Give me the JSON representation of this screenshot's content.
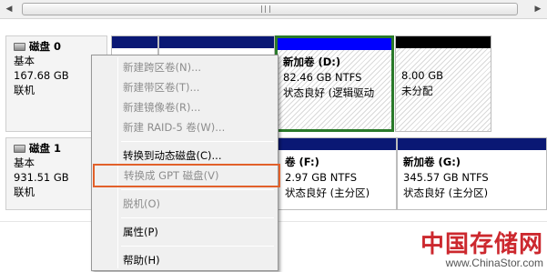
{
  "scrollbar": {
    "left_arrow": "◀",
    "right_arrow": "▶"
  },
  "disk0": {
    "title": "磁盘 0",
    "type": "基本",
    "size": "167.68 GB",
    "status": "联机",
    "partitions": [
      {
        "name": "新加卷 (D:)",
        "size": "82.46 GB NTFS",
        "status": "状态良好 (逻辑驱动"
      },
      {
        "name": "",
        "size": "8.00 GB",
        "status": "未分配"
      }
    ]
  },
  "disk1": {
    "title": "磁盘 1",
    "type": "基本",
    "size": "931.51 GB",
    "status": "联机",
    "partitions": [
      {
        "name": "卷 (F:)",
        "size": "2.97 GB NTFS",
        "status": "状态良好 (主分区)"
      },
      {
        "name": "新加卷 (G:)",
        "size": "345.57 GB NTFS",
        "status": "状态良好 (主分区)"
      }
    ]
  },
  "context_menu": {
    "items": [
      {
        "label": "新建跨区卷(N)...",
        "enabled": false
      },
      {
        "label": "新建带区卷(T)...",
        "enabled": false
      },
      {
        "label": "新建镜像卷(R)...",
        "enabled": false
      },
      {
        "label": "新建 RAID-5 卷(W)...",
        "enabled": false
      },
      {
        "label": "转换到动态磁盘(C)...",
        "enabled": true
      },
      {
        "label": "转换成 GPT 磁盘(V)",
        "enabled": false
      },
      {
        "label": "脱机(O)",
        "enabled": false
      },
      {
        "label": "属性(P)",
        "enabled": true
      },
      {
        "label": "帮助(H)",
        "enabled": true
      }
    ]
  },
  "watermark": {
    "logo": "中国存储网",
    "url": "www.ChinaStor.com"
  }
}
